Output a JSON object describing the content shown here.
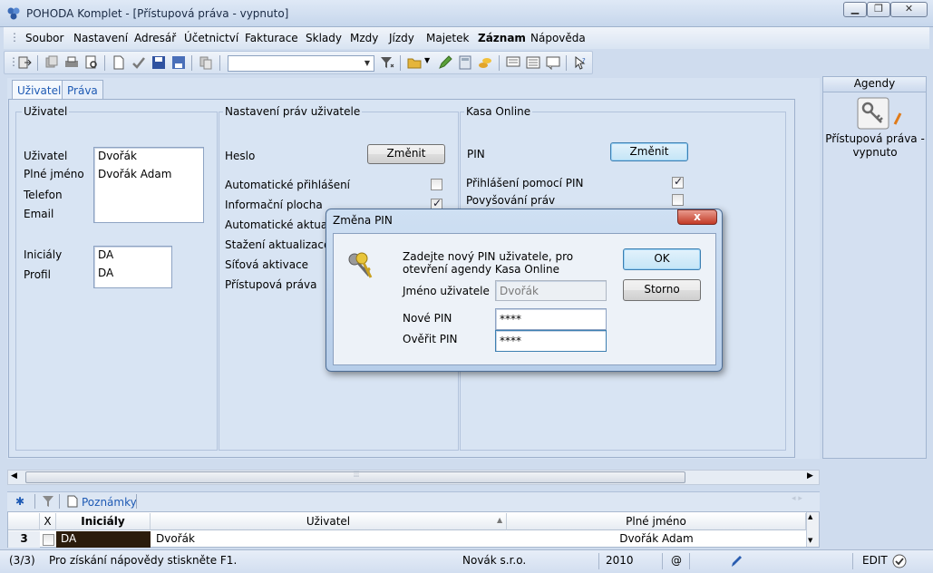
{
  "window": {
    "title": "POHODA Komplet - [Přístupová práva - vypnuto]",
    "minimize_icon": "minimize-icon",
    "restore_icon": "restore-icon",
    "close_icon": "close-icon"
  },
  "menu": [
    {
      "label": "Soubor",
      "bold": false
    },
    {
      "label": "Nastavení",
      "bold": false
    },
    {
      "label": "Adresář",
      "bold": false
    },
    {
      "label": "Účetnictví",
      "bold": false
    },
    {
      "label": "Fakturace",
      "bold": false
    },
    {
      "label": "Sklady",
      "bold": false
    },
    {
      "label": "Mzdy",
      "bold": false
    },
    {
      "label": "Jízdy",
      "bold": false
    },
    {
      "label": "Majetek",
      "bold": false
    },
    {
      "label": "Záznam",
      "bold": true
    },
    {
      "label": "Nápověda",
      "bold": false
    }
  ],
  "toolbar": {
    "combo_value": ""
  },
  "tabs": [
    "Uživatel",
    "Práva"
  ],
  "user_group": {
    "title": "Uživatel",
    "labels": {
      "user": "Uživatel",
      "fullname": "Plné jméno",
      "phone": "Telefon",
      "email": "Email",
      "initials": "Iniciály",
      "profile": "Profil"
    },
    "values": {
      "user": "Dvořák",
      "fullname": "Dvořák Adam",
      "initials": "DA",
      "profile": "DA"
    }
  },
  "rights_group": {
    "title": "Nastavení práv uživatele",
    "password_label": "Heslo",
    "change_button": "Změnit",
    "items": [
      {
        "label": "Automatické přihlášení",
        "checked": false
      },
      {
        "label": "Informační plocha",
        "checked": true
      },
      {
        "label": "Automatické aktualiz",
        "checked": false
      },
      {
        "label": "Stažení aktualizace",
        "checked": false
      },
      {
        "label": "Síťová aktivace",
        "checked": false
      },
      {
        "label": "Přístupová práva",
        "checked": false
      }
    ]
  },
  "kasa_group": {
    "title": "Kasa Online",
    "pin_label": "PIN",
    "change_button": "Změnit",
    "items": [
      {
        "label": "Přihlášení pomocí PIN",
        "checked": true
      },
      {
        "label": "Povyšování práv",
        "checked": false
      }
    ]
  },
  "dialog": {
    "title": "Změna PIN",
    "close_label": "x",
    "message": "Zadejte nový PIN uživatele, pro otevření agendy Kasa Online",
    "username_label": "Jméno uživatele",
    "username_value": "Dvořák",
    "new_pin_label": "Nové PIN",
    "new_pin_value": "****",
    "verify_pin_label": "Ověřit PIN",
    "verify_pin_value": "****",
    "ok_button": "OK",
    "cancel_button": "Storno"
  },
  "agendy": {
    "title": "Agendy",
    "item_label": "Přístupová práva - vypnuto"
  },
  "bottom_tabs": {
    "notes_label": "Poznámky"
  },
  "grid": {
    "columns": [
      "X",
      "Iniciály",
      "Uživatel",
      "Plné jméno"
    ],
    "row": {
      "number": "3",
      "initials": "DA",
      "user": "Dvořák",
      "fullname": "Dvořák Adam"
    }
  },
  "status": {
    "record": "(3/3)",
    "help": "Pro získání nápovědy stiskněte F1.",
    "company": "Novák  s.r.o.",
    "year": "2010",
    "at": "@",
    "mode": "EDIT"
  },
  "colors": {
    "accent": "#1e5ab4",
    "selected_cell": "#2b1c0c",
    "dialog_frame": "#4d6d95"
  }
}
